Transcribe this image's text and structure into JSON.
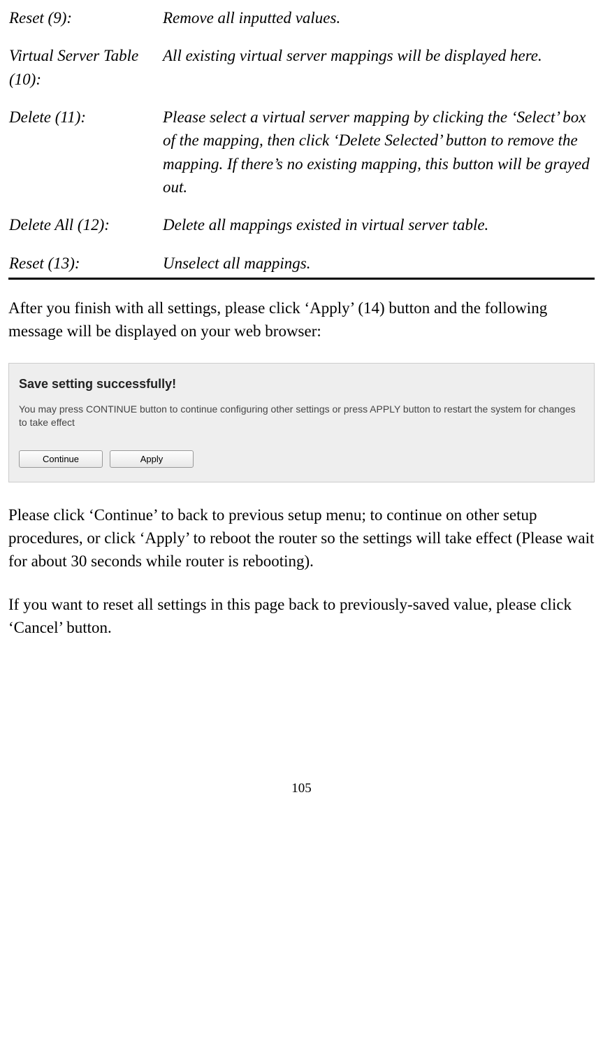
{
  "definitions": [
    {
      "term": "Reset (9):",
      "desc": "Remove all inputted values."
    },
    {
      "term": "Virtual Server Table (10):",
      "desc": "All existing virtual server mappings will be displayed here."
    },
    {
      "term": "Delete (11):",
      "desc": "Please select a virtual server mapping by clicking the ‘Select’ box of the mapping, then click ‘Delete Selected’ button to remove the mapping. If there’s no existing mapping, this button will be grayed out."
    },
    {
      "term": "Delete All (12):",
      "desc": "Delete all mappings existed in virtual server table."
    },
    {
      "term": "Reset (13):",
      "desc": "Unselect all mappings."
    }
  ],
  "para1": "After you finish with all settings, please click ‘Apply’ (14) button and the following message will be displayed on your web browser:",
  "dialog": {
    "title": "Save setting successfully!",
    "message": "You may press CONTINUE button to continue configuring other settings or press APPLY button to restart the system for changes to take effect",
    "continue_label": "Continue",
    "apply_label": "Apply"
  },
  "para2": "Please click ‘Continue’ to back to previous setup menu; to continue on other setup procedures, or click ‘Apply’ to reboot the router so the settings will take effect (Please wait for about 30 seconds while router is rebooting).",
  "para3": "If you want to reset all settings in this page back to previously-saved value, please click ‘Cancel’ button.",
  "page_number": "105"
}
